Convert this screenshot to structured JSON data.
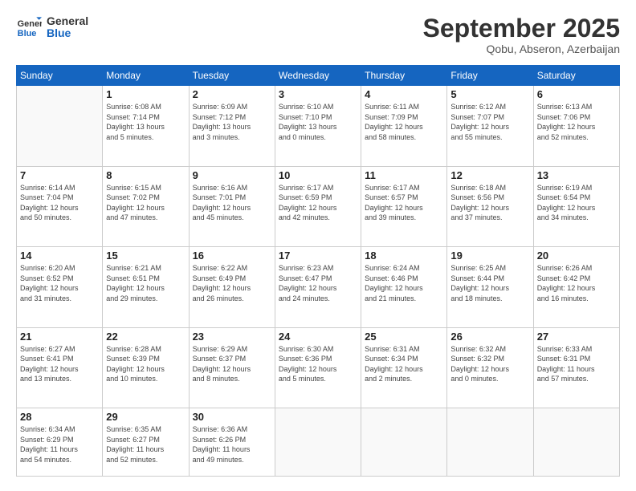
{
  "logo": {
    "line1": "General",
    "line2": "Blue"
  },
  "title": "September 2025",
  "location": "Qobu, Abseron, Azerbaijan",
  "days_of_week": [
    "Sunday",
    "Monday",
    "Tuesday",
    "Wednesday",
    "Thursday",
    "Friday",
    "Saturday"
  ],
  "weeks": [
    [
      {
        "day": "",
        "info": ""
      },
      {
        "day": "1",
        "info": "Sunrise: 6:08 AM\nSunset: 7:14 PM\nDaylight: 13 hours\nand 5 minutes."
      },
      {
        "day": "2",
        "info": "Sunrise: 6:09 AM\nSunset: 7:12 PM\nDaylight: 13 hours\nand 3 minutes."
      },
      {
        "day": "3",
        "info": "Sunrise: 6:10 AM\nSunset: 7:10 PM\nDaylight: 13 hours\nand 0 minutes."
      },
      {
        "day": "4",
        "info": "Sunrise: 6:11 AM\nSunset: 7:09 PM\nDaylight: 12 hours\nand 58 minutes."
      },
      {
        "day": "5",
        "info": "Sunrise: 6:12 AM\nSunset: 7:07 PM\nDaylight: 12 hours\nand 55 minutes."
      },
      {
        "day": "6",
        "info": "Sunrise: 6:13 AM\nSunset: 7:06 PM\nDaylight: 12 hours\nand 52 minutes."
      }
    ],
    [
      {
        "day": "7",
        "info": "Sunrise: 6:14 AM\nSunset: 7:04 PM\nDaylight: 12 hours\nand 50 minutes."
      },
      {
        "day": "8",
        "info": "Sunrise: 6:15 AM\nSunset: 7:02 PM\nDaylight: 12 hours\nand 47 minutes."
      },
      {
        "day": "9",
        "info": "Sunrise: 6:16 AM\nSunset: 7:01 PM\nDaylight: 12 hours\nand 45 minutes."
      },
      {
        "day": "10",
        "info": "Sunrise: 6:17 AM\nSunset: 6:59 PM\nDaylight: 12 hours\nand 42 minutes."
      },
      {
        "day": "11",
        "info": "Sunrise: 6:17 AM\nSunset: 6:57 PM\nDaylight: 12 hours\nand 39 minutes."
      },
      {
        "day": "12",
        "info": "Sunrise: 6:18 AM\nSunset: 6:56 PM\nDaylight: 12 hours\nand 37 minutes."
      },
      {
        "day": "13",
        "info": "Sunrise: 6:19 AM\nSunset: 6:54 PM\nDaylight: 12 hours\nand 34 minutes."
      }
    ],
    [
      {
        "day": "14",
        "info": "Sunrise: 6:20 AM\nSunset: 6:52 PM\nDaylight: 12 hours\nand 31 minutes."
      },
      {
        "day": "15",
        "info": "Sunrise: 6:21 AM\nSunset: 6:51 PM\nDaylight: 12 hours\nand 29 minutes."
      },
      {
        "day": "16",
        "info": "Sunrise: 6:22 AM\nSunset: 6:49 PM\nDaylight: 12 hours\nand 26 minutes."
      },
      {
        "day": "17",
        "info": "Sunrise: 6:23 AM\nSunset: 6:47 PM\nDaylight: 12 hours\nand 24 minutes."
      },
      {
        "day": "18",
        "info": "Sunrise: 6:24 AM\nSunset: 6:46 PM\nDaylight: 12 hours\nand 21 minutes."
      },
      {
        "day": "19",
        "info": "Sunrise: 6:25 AM\nSunset: 6:44 PM\nDaylight: 12 hours\nand 18 minutes."
      },
      {
        "day": "20",
        "info": "Sunrise: 6:26 AM\nSunset: 6:42 PM\nDaylight: 12 hours\nand 16 minutes."
      }
    ],
    [
      {
        "day": "21",
        "info": "Sunrise: 6:27 AM\nSunset: 6:41 PM\nDaylight: 12 hours\nand 13 minutes."
      },
      {
        "day": "22",
        "info": "Sunrise: 6:28 AM\nSunset: 6:39 PM\nDaylight: 12 hours\nand 10 minutes."
      },
      {
        "day": "23",
        "info": "Sunrise: 6:29 AM\nSunset: 6:37 PM\nDaylight: 12 hours\nand 8 minutes."
      },
      {
        "day": "24",
        "info": "Sunrise: 6:30 AM\nSunset: 6:36 PM\nDaylight: 12 hours\nand 5 minutes."
      },
      {
        "day": "25",
        "info": "Sunrise: 6:31 AM\nSunset: 6:34 PM\nDaylight: 12 hours\nand 2 minutes."
      },
      {
        "day": "26",
        "info": "Sunrise: 6:32 AM\nSunset: 6:32 PM\nDaylight: 12 hours\nand 0 minutes."
      },
      {
        "day": "27",
        "info": "Sunrise: 6:33 AM\nSunset: 6:31 PM\nDaylight: 11 hours\nand 57 minutes."
      }
    ],
    [
      {
        "day": "28",
        "info": "Sunrise: 6:34 AM\nSunset: 6:29 PM\nDaylight: 11 hours\nand 54 minutes."
      },
      {
        "day": "29",
        "info": "Sunrise: 6:35 AM\nSunset: 6:27 PM\nDaylight: 11 hours\nand 52 minutes."
      },
      {
        "day": "30",
        "info": "Sunrise: 6:36 AM\nSunset: 6:26 PM\nDaylight: 11 hours\nand 49 minutes."
      },
      {
        "day": "",
        "info": ""
      },
      {
        "day": "",
        "info": ""
      },
      {
        "day": "",
        "info": ""
      },
      {
        "day": "",
        "info": ""
      }
    ]
  ]
}
